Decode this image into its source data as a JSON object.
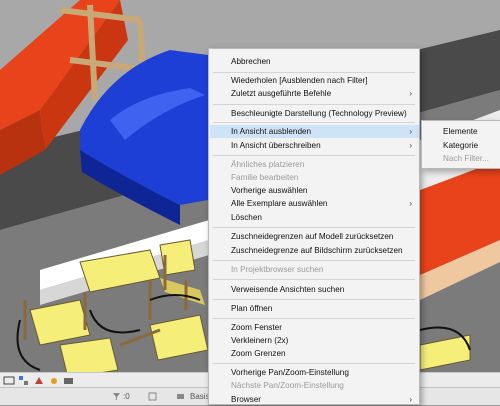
{
  "context_menu": {
    "items": [
      {
        "label": "Abbrechen",
        "state": "normal"
      },
      {
        "label": "Wiederholen [Ausblenden nach Filter]",
        "state": "normal"
      },
      {
        "label": "Zuletzt ausgeführte Befehle",
        "state": "normal",
        "submenu": true
      },
      {
        "label": "Beschleunigte Darstellung (Technology Preview)",
        "state": "normal"
      },
      {
        "label": "In Ansicht ausblenden",
        "state": "hover",
        "submenu": true
      },
      {
        "label": "In Ansicht überschreiben",
        "state": "normal",
        "submenu": true
      },
      {
        "label": "Ähnliches platzieren",
        "state": "disabled"
      },
      {
        "label": "Familie bearbeiten",
        "state": "disabled"
      },
      {
        "label": "Vorherige auswählen",
        "state": "normal"
      },
      {
        "label": "Alle Exemplare auswählen",
        "state": "normal",
        "submenu": true
      },
      {
        "label": "Löschen",
        "state": "normal"
      },
      {
        "label": "Zuschneidegrenzen auf Modell zurücksetzen",
        "state": "normal"
      },
      {
        "label": "Zuschneidegrenze auf Bildschirm zurücksetzen",
        "state": "normal"
      },
      {
        "label": "In Projektbrowser suchen",
        "state": "disabled"
      },
      {
        "label": "Verweisende Ansichten suchen",
        "state": "normal"
      },
      {
        "label": "Plan öffnen",
        "state": "normal"
      },
      {
        "label": "Zoom Fenster",
        "state": "normal"
      },
      {
        "label": "Verkleinern (2x)",
        "state": "normal"
      },
      {
        "label": "Zoom Grenzen",
        "state": "normal"
      },
      {
        "label": "Vorherige Pan/Zoom-Einstellung",
        "state": "normal"
      },
      {
        "label": "Nächste Pan/Zoom-Einstellung",
        "state": "disabled"
      },
      {
        "label": "Browser",
        "state": "normal",
        "submenu": true
      }
    ]
  },
  "submenu": {
    "items": [
      {
        "label": "Elemente",
        "state": "hover"
      },
      {
        "label": "Kategorie",
        "state": "normal"
      },
      {
        "label": "Nach Filter...",
        "state": "disabled"
      }
    ]
  },
  "status_bar": {
    "selection_count": ":0",
    "view_name": "Basis"
  },
  "icons": {
    "submenu_arrow": "›"
  },
  "colors": {
    "menu_hover": "#cfe3f7",
    "sofa_blue": "#1d3fd6",
    "sofa_orange": "#e8431a",
    "chair_yellow": "#f5ef7a"
  }
}
